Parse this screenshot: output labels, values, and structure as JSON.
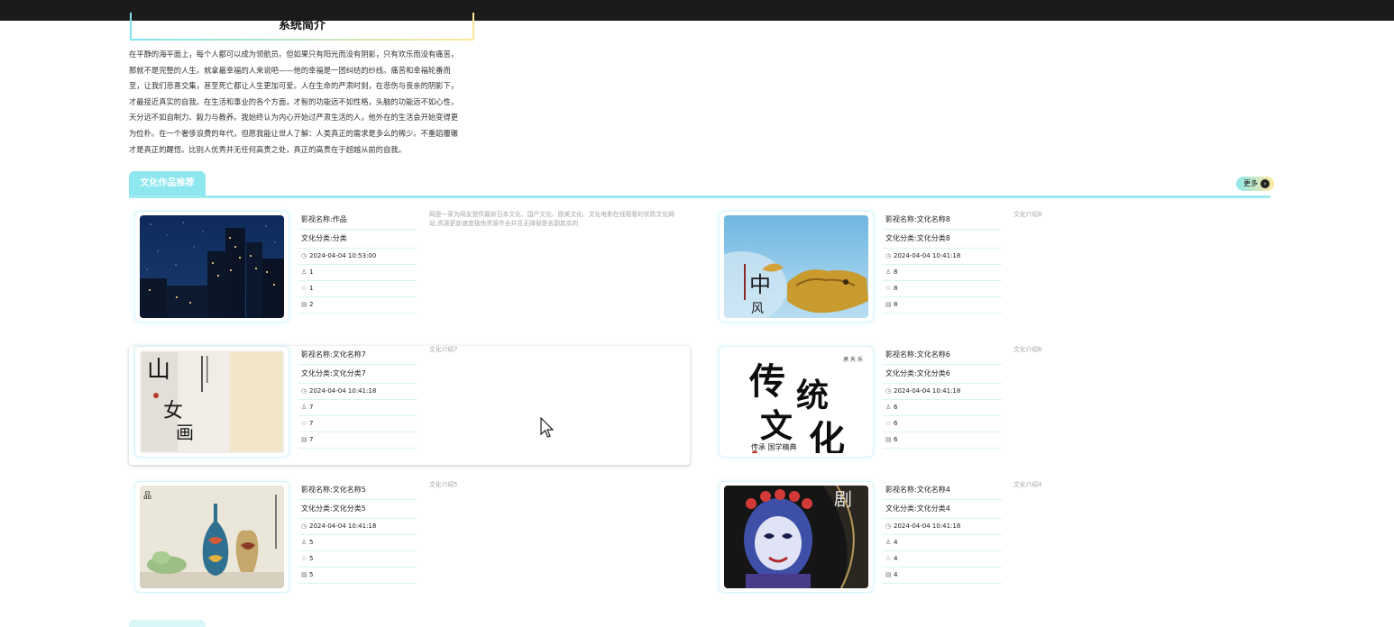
{
  "intro": {
    "title": "系统简介",
    "lines": [
      "在平静的海平面上，每个人都可以成为领航员。但如果只有阳光而没有阴影，只有欢乐而没有痛苦，",
      "那就不是完整的人生。就拿最幸福的人来说吧——他的幸福是一团纠结的纱线。痛苦和幸福轮番而",
      "至，让我们悲喜交集，甚至死亡都让人生更加可爱。人在生命的严肃时刻，在悲伤与丧亲的阴影下，",
      "才最接近真实的自我。在生活和事业的各个方面，才智的功能远不如性格，头脑的功能远不如心性，",
      "天分远不如自制力、毅力与教养。我始终认为内心开始过严肃生活的人，他外在的生活会开始变得更",
      "为俭朴。在一个奢侈浪费的年代，但愿我能让世人了解：人类真正的需求是多么的稀少。不重蹈覆辙",
      "才是真正的醒悟。比别人优秀并无任何高贵之处，真正的高贵在于超越从前的自我。"
    ]
  },
  "section": {
    "title": "文化作品推荐",
    "more_label": "更多",
    "more_icon": "arrow-right-circle-icon"
  },
  "accent_colors": {
    "primary": "#8ee7ef",
    "secondary": "#ffe89a"
  },
  "cards": [
    {
      "name": "影视名称:作品",
      "category": "文化分类:分类",
      "time": "2024-04-04 10:53:00",
      "likes": "1",
      "favorites": "1",
      "comments": "2",
      "desc": "网是一家为网友提供最新日本文化、国产文化、欧美文化、文化电影在线观看的优质文化网站,资源更新速度极快资源齐全并且无弹窗是名副其实的",
      "thumb": "city-night-image"
    },
    {
      "name": "影视名称:文化名称8",
      "category": "文化分类:文化分类8",
      "time": "2024-04-04 10:41:18",
      "likes": "8",
      "favorites": "8",
      "comments": "8",
      "desc": "文化介绍8",
      "thumb": "golden-dragon-image"
    },
    {
      "name": "影视名称:文化名称7",
      "category": "文化分类:文化分类7",
      "time": "2024-04-04 10:41:18",
      "likes": "7",
      "favorites": "7",
      "comments": "7",
      "desc": "文化介绍7",
      "thumb": "calligraphy-scroll-image"
    },
    {
      "name": "影视名称:文化名称6",
      "category": "文化分类:文化分类6",
      "time": "2024-04-04 10:41:18",
      "likes": "6",
      "favorites": "6",
      "comments": "6",
      "desc": "文化介绍6",
      "thumb": "traditional-culture-calligraphy-image"
    },
    {
      "name": "影视名称:文化名称5",
      "category": "文化分类:文化分类5",
      "time": "2024-04-04 10:41:18",
      "likes": "5",
      "favorites": "5",
      "comments": "5",
      "desc": "文化介绍5",
      "thumb": "porcelain-vases-image"
    },
    {
      "name": "影视名称:文化名称4",
      "category": "文化分类:文化分类4",
      "time": "2024-04-04 10:41:18",
      "likes": "4",
      "favorites": "4",
      "comments": "4",
      "desc": "文化介绍4",
      "thumb": "opera-mask-image"
    }
  ]
}
